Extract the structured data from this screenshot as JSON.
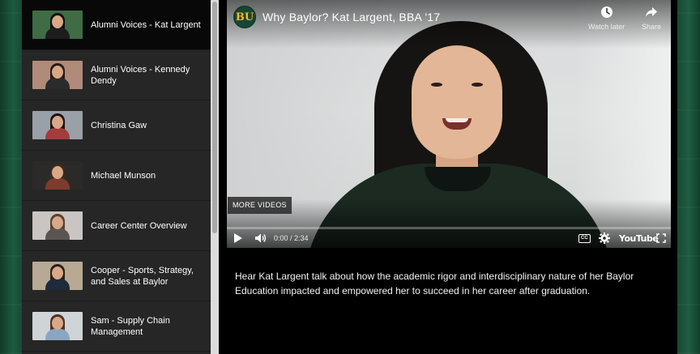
{
  "playlist": {
    "items": [
      {
        "title": "Alumni Voices - Kat Largent",
        "active": true,
        "thumb": {
          "bg": "#3f6b45",
          "hair": "#111111",
          "torso": "#1d1d1d"
        }
      },
      {
        "title": "Alumni Voices - Kennedy Dendy",
        "active": false,
        "thumb": {
          "bg": "#b08b7a",
          "hair": "#2a1a12",
          "torso": "#2b2b2b"
        }
      },
      {
        "title": "Christina Gaw",
        "active": false,
        "thumb": {
          "bg": "#9aa0a8",
          "hair": "#1a1412",
          "torso": "#a33c3c"
        }
      },
      {
        "title": "Michael Munson",
        "active": false,
        "thumb": {
          "bg": "#2b2a28",
          "hair": "#3a2a20",
          "torso": "#7f3b2c"
        }
      },
      {
        "title": "Career Center Overview",
        "active": false,
        "thumb": {
          "bg": "#c9c5c2",
          "hair": "#5a4030",
          "torso": "#5b5552"
        }
      },
      {
        "title": "Cooper - Sports, Strategy, and Sales at Baylor",
        "active": false,
        "thumb": {
          "bg": "#b7a993",
          "hair": "#2a2018",
          "torso": "#1f2a3a"
        }
      },
      {
        "title": "Sam - Supply Chain Management",
        "active": false,
        "thumb": {
          "bg": "#cfd4d6",
          "hair": "#4a3426",
          "torso": "#8aa6c2"
        }
      }
    ]
  },
  "player": {
    "channel_logo": "BU",
    "title": "Why Baylor? Kat Largent, BBA '17",
    "watch_later": "Watch later",
    "share": "Share",
    "more_videos": "MORE VIDEOS",
    "time": "0:00 / 2:34",
    "cc": "CC",
    "youtube": "YouTube",
    "progress": 0
  },
  "description": "Hear Kat Largent talk about how the academic rigor and interdisciplinary nature of her Baylor Education impacted and empowered her to succeed in her career after graduation.",
  "colors": {
    "baylor_green": "#154733",
    "baylor_gold": "#ffb81c",
    "playlist_bg": "#262626",
    "active_item_bg": "#080808"
  },
  "icons": {
    "watch_later": "clock-icon",
    "share": "share-arrow-icon",
    "play": "play-icon",
    "volume": "volume-icon",
    "settings": "gear-icon",
    "fullscreen": "fullscreen-icon"
  }
}
